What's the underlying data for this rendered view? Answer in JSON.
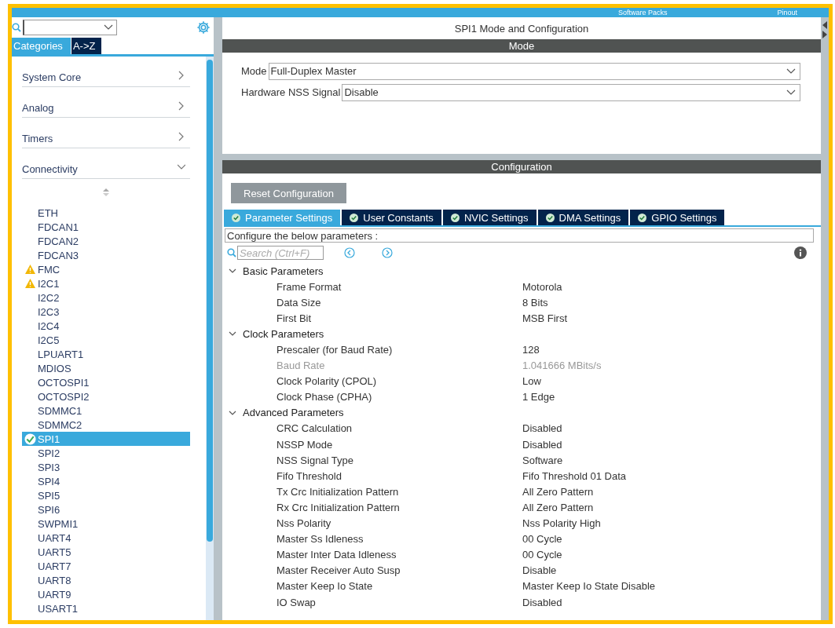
{
  "top_bar": {
    "tabs": [
      "Software Packs",
      "Pinout"
    ]
  },
  "sidebar": {
    "view_tabs": [
      {
        "label": "Categories",
        "selected": true
      },
      {
        "label": "A->Z",
        "selected": false
      }
    ],
    "categories": [
      {
        "label": "System Core",
        "expanded": false
      },
      {
        "label": "Analog",
        "expanded": false
      },
      {
        "label": "Timers",
        "expanded": false
      },
      {
        "label": "Connectivity",
        "expanded": true
      }
    ],
    "items": [
      {
        "label": "ETH",
        "warning": false,
        "configured": false,
        "selected": false
      },
      {
        "label": "FDCAN1",
        "warning": false,
        "configured": false,
        "selected": false
      },
      {
        "label": "FDCAN2",
        "warning": false,
        "configured": false,
        "selected": false
      },
      {
        "label": "FDCAN3",
        "warning": false,
        "configured": false,
        "selected": false
      },
      {
        "label": "FMC",
        "warning": true,
        "configured": false,
        "selected": false
      },
      {
        "label": "I2C1",
        "warning": true,
        "configured": false,
        "selected": false
      },
      {
        "label": "I2C2",
        "warning": false,
        "configured": false,
        "selected": false
      },
      {
        "label": "I2C3",
        "warning": false,
        "configured": false,
        "selected": false
      },
      {
        "label": "I2C4",
        "warning": false,
        "configured": false,
        "selected": false
      },
      {
        "label": "I2C5",
        "warning": false,
        "configured": false,
        "selected": false
      },
      {
        "label": "LPUART1",
        "warning": false,
        "configured": false,
        "selected": false
      },
      {
        "label": "MDIOS",
        "warning": false,
        "configured": false,
        "selected": false
      },
      {
        "label": "OCTOSPI1",
        "warning": false,
        "configured": false,
        "selected": false
      },
      {
        "label": "OCTOSPI2",
        "warning": false,
        "configured": false,
        "selected": false
      },
      {
        "label": "SDMMC1",
        "warning": false,
        "configured": false,
        "selected": false
      },
      {
        "label": "SDMMC2",
        "warning": false,
        "configured": false,
        "selected": false
      },
      {
        "label": "SPI1",
        "warning": false,
        "configured": true,
        "selected": true
      },
      {
        "label": "SPI2",
        "warning": false,
        "configured": false,
        "selected": false
      },
      {
        "label": "SPI3",
        "warning": false,
        "configured": false,
        "selected": false
      },
      {
        "label": "SPI4",
        "warning": false,
        "configured": false,
        "selected": false
      },
      {
        "label": "SPI5",
        "warning": false,
        "configured": false,
        "selected": false
      },
      {
        "label": "SPI6",
        "warning": false,
        "configured": false,
        "selected": false
      },
      {
        "label": "SWPMI1",
        "warning": false,
        "configured": false,
        "selected": false
      },
      {
        "label": "UART4",
        "warning": false,
        "configured": false,
        "selected": false
      },
      {
        "label": "UART5",
        "warning": false,
        "configured": false,
        "selected": false
      },
      {
        "label": "UART7",
        "warning": false,
        "configured": false,
        "selected": false
      },
      {
        "label": "UART8",
        "warning": false,
        "configured": false,
        "selected": false
      },
      {
        "label": "UART9",
        "warning": false,
        "configured": false,
        "selected": false
      },
      {
        "label": "USART1",
        "warning": false,
        "configured": false,
        "selected": false
      }
    ]
  },
  "main": {
    "title": "SPI1 Mode and Configuration",
    "mode_section": {
      "title": "Mode",
      "fields": [
        {
          "label": "Mode",
          "value": "Full-Duplex Master"
        },
        {
          "label": "Hardware NSS Signal",
          "value": "Disable"
        }
      ]
    },
    "configuration": {
      "title": "Configuration",
      "reset_button": "Reset Configuration",
      "tabs": [
        {
          "label": "Parameter Settings",
          "selected": true
        },
        {
          "label": "User Constants",
          "selected": false
        },
        {
          "label": "NVIC Settings",
          "selected": false
        },
        {
          "label": "DMA Settings",
          "selected": false
        },
        {
          "label": "GPIO Settings",
          "selected": false
        }
      ],
      "hint": "Configure the below parameters :",
      "search": {
        "placeholder": "Search (Ctrl+F)"
      },
      "groups": [
        {
          "label": "Basic Parameters",
          "expanded": true,
          "children": [
            {
              "name": "Frame Format",
              "value": "Motorola",
              "disabled": false
            },
            {
              "name": "Data Size",
              "value": "8 Bits",
              "disabled": false
            },
            {
              "name": "First Bit",
              "value": "MSB First",
              "disabled": false
            }
          ]
        },
        {
          "label": "Clock Parameters",
          "expanded": true,
          "children": [
            {
              "name": "Prescaler (for Baud Rate)",
              "value": "128",
              "disabled": false
            },
            {
              "name": "Baud Rate",
              "value": "1.041666 MBits/s",
              "disabled": true
            },
            {
              "name": "Clock Polarity (CPOL)",
              "value": "Low",
              "disabled": false
            },
            {
              "name": "Clock Phase (CPHA)",
              "value": "1 Edge",
              "disabled": false
            }
          ]
        },
        {
          "label": "Advanced Parameters",
          "expanded": true,
          "children": [
            {
              "name": "CRC Calculation",
              "value": "Disabled",
              "disabled": false
            },
            {
              "name": "NSSP Mode",
              "value": "Disabled",
              "disabled": false
            },
            {
              "name": "NSS Signal Type",
              "value": "Software",
              "disabled": false
            },
            {
              "name": "Fifo Threshold",
              "value": "Fifo Threshold 01 Data",
              "disabled": false
            },
            {
              "name": "Tx Crc Initialization Pattern",
              "value": "All Zero Pattern",
              "disabled": false
            },
            {
              "name": "Rx Crc Initialization Pattern",
              "value": "All Zero Pattern",
              "disabled": false
            },
            {
              "name": "Nss Polarity",
              "value": "Nss Polarity High",
              "disabled": false
            },
            {
              "name": "Master Ss Idleness",
              "value": "00 Cycle",
              "disabled": false
            },
            {
              "name": "Master Inter Data Idleness",
              "value": "00 Cycle",
              "disabled": false
            },
            {
              "name": "Master Receiver Auto Susp",
              "value": "Disable",
              "disabled": false
            },
            {
              "name": "Master Keep Io State",
              "value": "Master Keep Io State Disable",
              "disabled": false
            },
            {
              "name": "IO Swap",
              "value": "Disabled",
              "disabled": false
            }
          ]
        }
      ]
    }
  }
}
